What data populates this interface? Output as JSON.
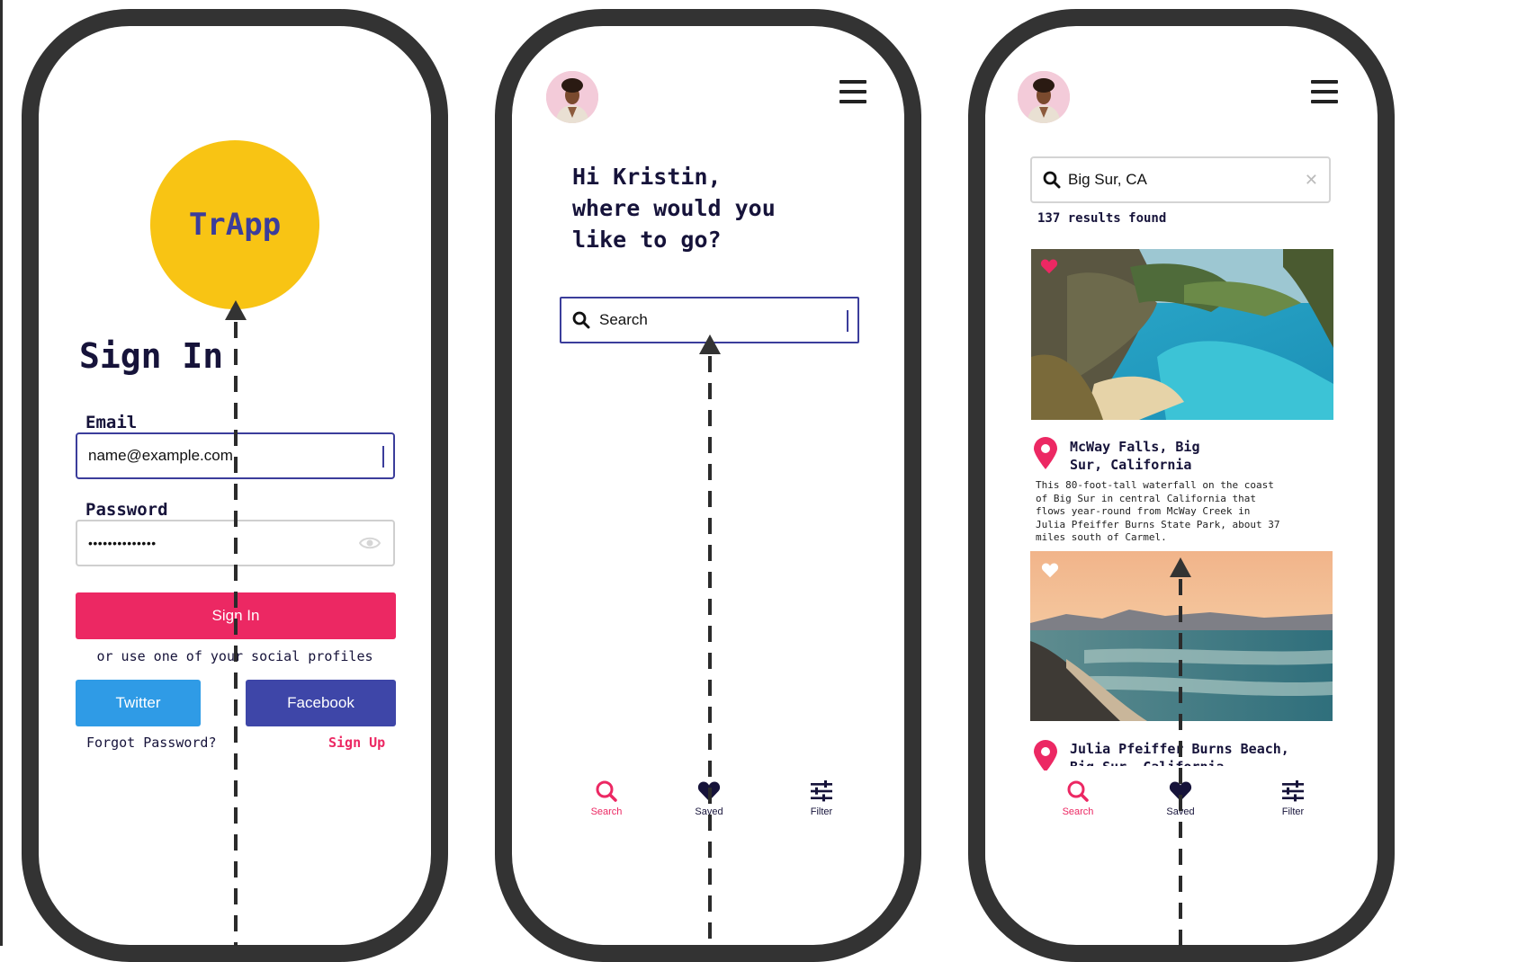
{
  "signin_screen": {
    "logo": "TrApp",
    "title": "Sign In",
    "email_label": "Email",
    "email_value": "name@example.com",
    "password_label": "Password",
    "password_value": "••••••••••••••",
    "signin_button": "Sign In",
    "social_text": "or use one of your social profiles",
    "twitter_button": "Twitter",
    "facebook_button": "Facebook",
    "forgot_password": "Forgot Password?",
    "sign_up": "Sign Up"
  },
  "search_screen": {
    "greeting": [
      "Hi Kristin,",
      "where would you",
      "like to go?"
    ],
    "search_placeholder": "Search"
  },
  "results_screen": {
    "search_value": "Big Sur, CA",
    "results_count": "137 results found",
    "places": [
      {
        "title": [
          "McWay Falls, Big",
          "Sur, California"
        ],
        "description": [
          "This 80-foot-tall waterfall on the coast",
          "of Big Sur in central California that",
          "flows year-round from McWay Creek in",
          "Julia Pfeiffer Burns State Park, about 37",
          "miles south of Carmel."
        ],
        "saved": true
      },
      {
        "title": [
          "Julia Pfeiffer Burns Beach,",
          "Big Sur, California"
        ],
        "saved": false
      }
    ]
  },
  "bottom_nav": {
    "search": "Search",
    "saved": "Saved",
    "filter": "Filter"
  },
  "colors": {
    "accent_pink": "#ec2863",
    "logo_yellow": "#f8c414",
    "navy": "#16133a",
    "twitter_blue": "#2f9be6",
    "facebook_indigo": "#3e46a8",
    "frame": "#333333"
  }
}
